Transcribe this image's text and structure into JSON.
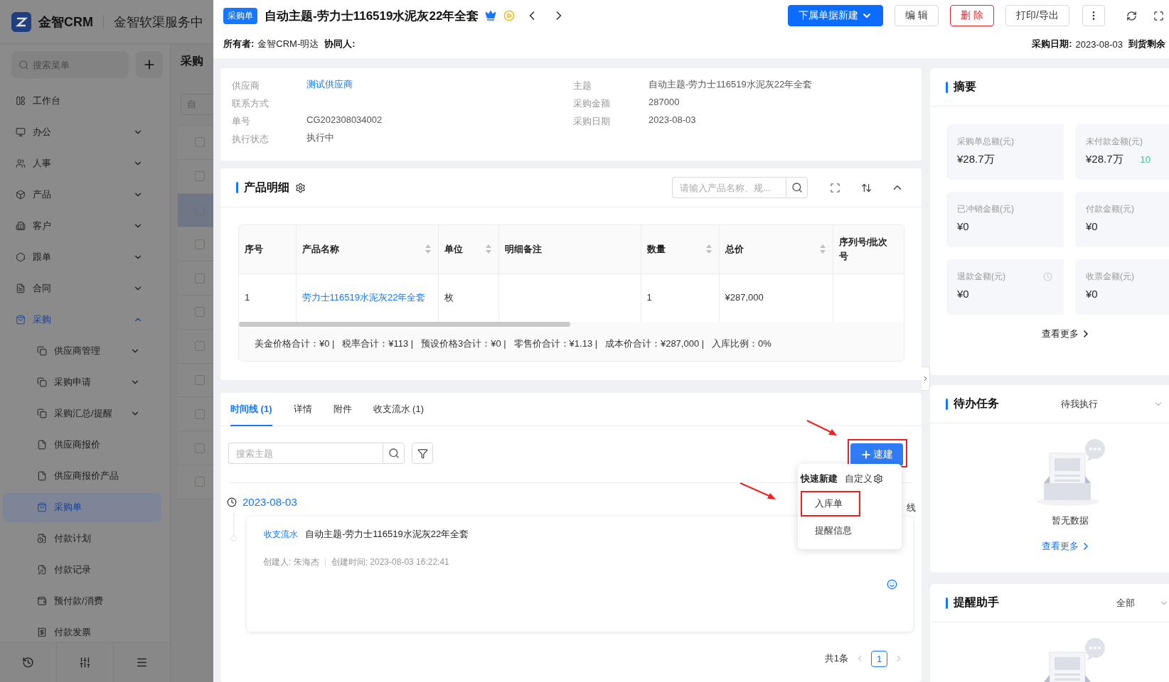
{
  "sidebar": {
    "brand": "金智CRM",
    "org": "金智软渠服务中",
    "search": {
      "placeholder": "搜索菜单"
    },
    "menu": [
      {
        "label": "工作台",
        "selected": false
      },
      {
        "label": "办公",
        "selected": false,
        "expanded": false
      },
      {
        "label": "人事",
        "selected": false,
        "expanded": false
      },
      {
        "label": "产品",
        "selected": false,
        "expanded": false
      },
      {
        "label": "客户",
        "selected": false,
        "expanded": false
      },
      {
        "label": "跟单",
        "selected": false,
        "expanded": false
      },
      {
        "label": "合同",
        "selected": false,
        "expanded": false
      },
      {
        "label": "采购",
        "selected": false,
        "expanded": true,
        "children": [
          {
            "label": "供应商管理",
            "selected": false,
            "expanded": false
          },
          {
            "label": "采购申请",
            "selected": false,
            "expanded": false
          },
          {
            "label": "采购汇总/提醒",
            "selected": false,
            "expanded": false
          },
          {
            "label": "供应商报价",
            "selected": false
          },
          {
            "label": "供应商报价产品",
            "selected": false
          },
          {
            "label": "采购单",
            "selected": true
          },
          {
            "label": "付款计划",
            "selected": false
          },
          {
            "label": "付款记录",
            "selected": false
          },
          {
            "label": "预付款/消费",
            "selected": false
          },
          {
            "label": "付款发票",
            "selected": false
          }
        ]
      }
    ]
  },
  "background_page": {
    "title": "采购",
    "filter_placeholder": "自",
    "rows": [
      {
        "selected": false,
        "checked": false
      },
      {
        "selected": false,
        "checked": false
      },
      {
        "selected": true,
        "checked": false
      },
      {
        "selected": false,
        "checked": false
      },
      {
        "selected": false,
        "checked": false
      },
      {
        "selected": false,
        "checked": false
      },
      {
        "selected": false,
        "checked": false
      },
      {
        "selected": false,
        "checked": false
      },
      {
        "selected": false,
        "checked": false
      },
      {
        "selected": false,
        "checked": false
      },
      {
        "selected": false,
        "checked": false
      }
    ]
  },
  "drawer": {
    "badge": "采购单",
    "title": "自动主题-劳力士116519水泥灰22年全套",
    "actions": [
      {
        "label": "下属单据新建",
        "kind": "primary"
      },
      {
        "label": "编 辑",
        "kind": "default"
      },
      {
        "label": "删 除",
        "kind": "danger"
      },
      {
        "label": "打印/导出",
        "kind": "default"
      }
    ],
    "owner_label": "所有者:",
    "owner": "金智CRM-明达",
    "collaborator_label": "协同人:",
    "date_label": "采购日期:",
    "date": "2023-08-03",
    "arrival_label": "到货剩余"
  },
  "info": {
    "left": [
      {
        "label": "供应商",
        "value": "测试供应商",
        "link": true
      },
      {
        "label": "联系方式"
      },
      {
        "label": "单号",
        "value": "CG202308034002",
        "link": false
      },
      {
        "label": "执行状态",
        "value": "执行中",
        "link": false
      }
    ],
    "right": [
      {
        "label": "主题",
        "value": "自动主题-劳力士116519水泥灰22年全套",
        "link": false
      },
      {
        "label": "采购金额",
        "value": "287000",
        "link": false
      },
      {
        "label": "采购日期",
        "value": "2023-08-03",
        "link": false
      }
    ]
  },
  "products": {
    "title": "产品明细",
    "search": {
      "placeholder": "请输入产品名称、规..."
    },
    "columns": [
      {
        "label": "序号",
        "sortable": false,
        "kind": "text"
      },
      {
        "label": "产品名称",
        "sortable": true,
        "kind": "link"
      },
      {
        "label": "单位",
        "sortable": true,
        "kind": "text"
      },
      {
        "label": "明细备注",
        "sortable": false,
        "kind": "text"
      },
      {
        "label": "数量",
        "sortable": true,
        "kind": "text"
      },
      {
        "label": "总价",
        "sortable": true,
        "kind": "text"
      },
      {
        "label": "序列号/批次号",
        "sortable": false,
        "kind": "text"
      }
    ],
    "rows": [
      [
        "1",
        "劳力士116519水泥灰22年全套",
        "枚",
        "",
        "1",
        "¥287,000",
        ""
      ]
    ],
    "summary": "美金价格合计：¥0 |   税率合计：¥113 |   预设价格3合计：¥0 |   零售价合计：¥1.13 |   成本价合计：¥287,000 |   入库比例：0%"
  },
  "tabs": [
    {
      "label": "时间线 (1)",
      "selected": true
    },
    {
      "label": "详情",
      "selected": false
    },
    {
      "label": "附件",
      "selected": false
    },
    {
      "label": "收支流水 (1)",
      "selected": false
    }
  ],
  "timeline": {
    "search": {
      "placeholder": "搜索主题"
    },
    "quick_button": {
      "label": "速建",
      "annotated": true
    },
    "popup": {
      "title": "快速新建",
      "custom": "自定义",
      "items": [
        {
          "label": "入库单",
          "annotated": true
        },
        {
          "label": "提醒信息",
          "annotated": false
        }
      ]
    },
    "date": "2023-08-03",
    "aside": "线",
    "entry": {
      "tag": "收支流水",
      "title": "自动主题-劳力士116519水泥灰22年全套",
      "creator": "创建人: 朱海杰",
      "created": "创建时间: 2023-08-03 16:22:41"
    },
    "pagination": {
      "total": "共1条",
      "pages": [
        {
          "label": "1",
          "selected": true
        }
      ]
    }
  },
  "summary": {
    "title": "摘要",
    "tiles": [
      {
        "label": "采购单总额(元)",
        "value": "¥28.7万",
        "kind": "plain"
      },
      {
        "label": "未付款金额(元)",
        "value": "¥28.7万",
        "kind": "plain",
        "trend": "10"
      },
      {
        "label": "已冲销金额(元)",
        "value": "¥0",
        "kind": "plain"
      },
      {
        "label": "付款金额(元)",
        "value": "¥0",
        "kind": "plain"
      },
      {
        "label": "退款金额(元)",
        "value": "¥0",
        "kind": "timed"
      },
      {
        "label": "收票金额(元)",
        "value": "¥0",
        "kind": "plain"
      }
    ],
    "more": "查看更多"
  },
  "tasks": {
    "title": "待办任务",
    "filter": "待我执行",
    "empty": "暂无数据",
    "more": "查看更多"
  },
  "reminders": {
    "title": "提醒助手",
    "filter": "全部"
  }
}
